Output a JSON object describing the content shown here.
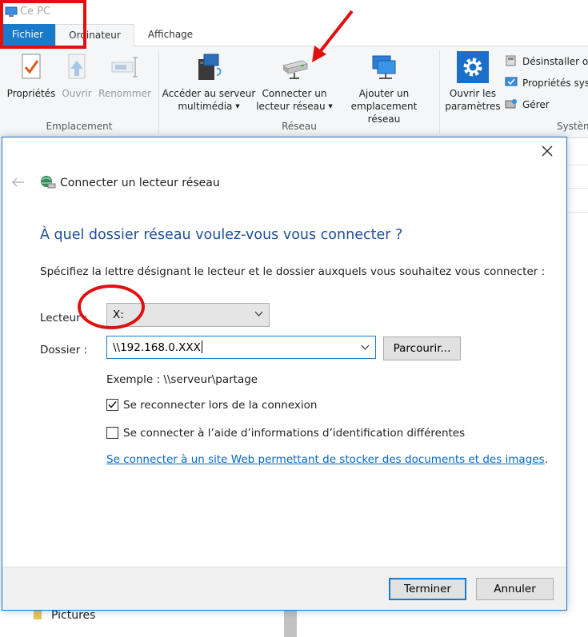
{
  "window": {
    "title": "Ce PC"
  },
  "ribbon_tabs": {
    "file": "Fichier",
    "computer": "Ordinateur",
    "view": "Affichage"
  },
  "ribbon": {
    "properties": "Propriétés",
    "open": "Ouvrir",
    "rename": "Renommer",
    "media_line1": "Accéder au serveur",
    "media_line2": "multimédia",
    "map_drive_line1": "Connecter un",
    "map_drive_line2": "lecteur réseau",
    "add_location_line1": "Ajouter un",
    "add_location_line2": "emplacement réseau",
    "settings_line1": "Ouvrir les",
    "settings_line2": "paramètres",
    "uninstall": "Désinstaller ou",
    "system_props": "Propriétés sys",
    "manage": "Gérer",
    "group_location": "Emplacement",
    "group_network": "Réseau",
    "group_system": "Systèm"
  },
  "background_items": {
    "pictures": "Pictures"
  },
  "dialog": {
    "title": "Connecter un lecteur réseau",
    "heading": "À quel dossier réseau voulez-vous vous connecter ?",
    "instruction": "Spécifiez la lettre désignant le lecteur et le dossier auxquels vous souhaitez vous connecter :",
    "drive_label": "Lecteur :",
    "drive_value": "X:",
    "folder_label": "Dossier :",
    "folder_value": "\\\\192.168.0.XXX",
    "browse": "Parcourir...",
    "example": "Exemple : \\\\serveur\\partage",
    "reconnect_label": "Se reconnecter lors de la connexion",
    "reconnect_checked": true,
    "credentials_label": "Se connecter à l’aide d’informations d’identification différentes",
    "credentials_checked": false,
    "link_text": "Se connecter à un site Web permettant de stocker des documents et des images",
    "link_suffix": ".",
    "finish": "Terminer",
    "cancel": "Annuler"
  },
  "colors": {
    "accent": "#1979ca",
    "heading": "#1f4e95",
    "link": "#0066cc",
    "annotation": "#e01010"
  }
}
